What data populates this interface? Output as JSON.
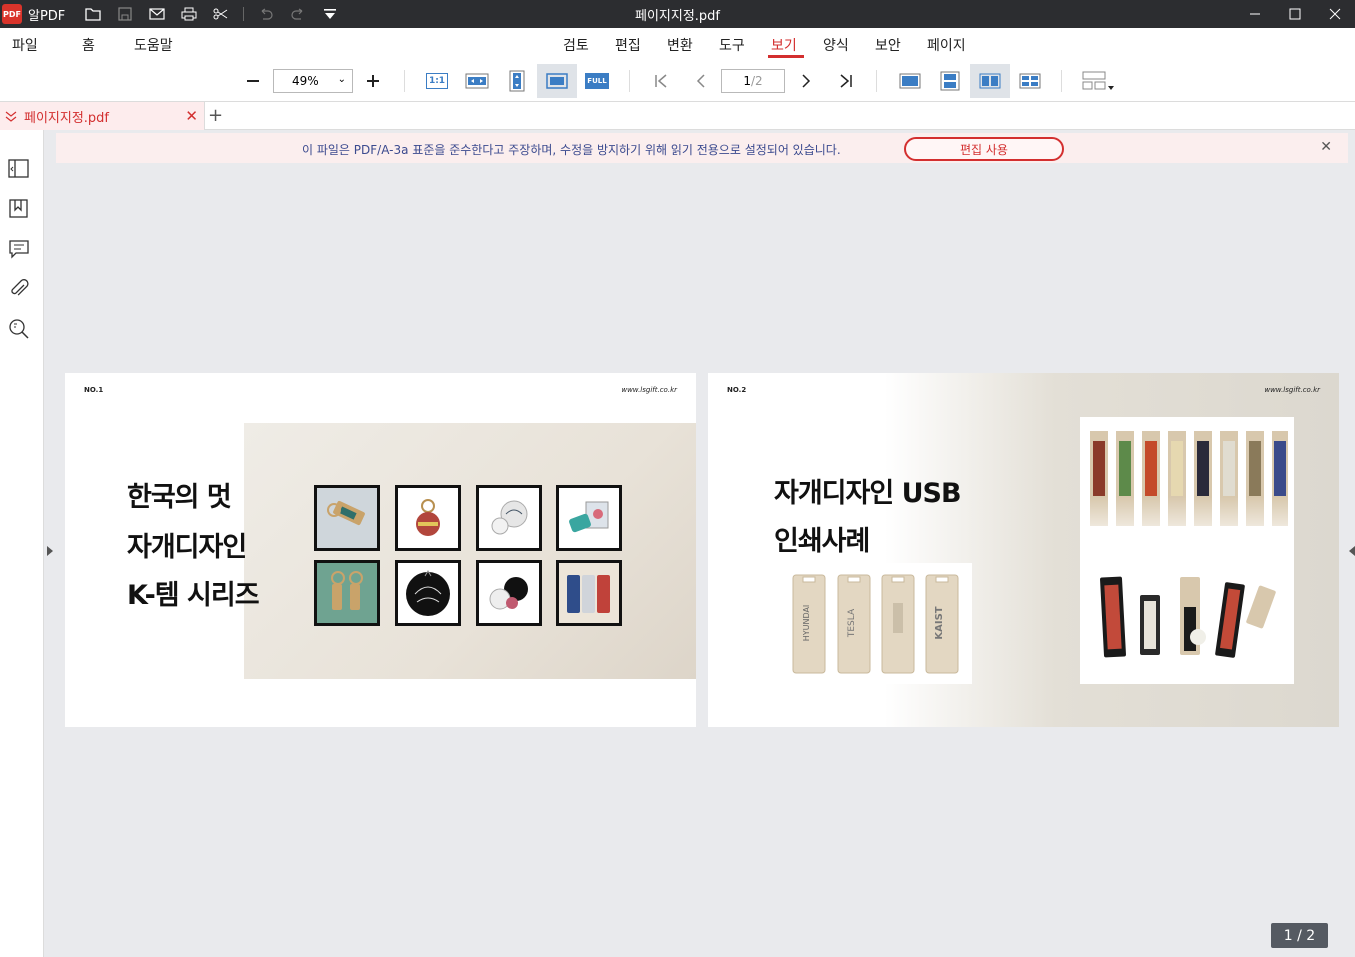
{
  "app": {
    "name": "알PDF",
    "window_title": "페이지지정.pdf"
  },
  "menu": {
    "items": [
      "파일",
      "홈",
      "도움말",
      "검토",
      "편집",
      "변환",
      "도구",
      "보기",
      "양식",
      "보안",
      "페이지"
    ],
    "active": "보기"
  },
  "toolbar": {
    "zoom_value": "49%",
    "page_current": "1",
    "page_total": "/2",
    "actual_size_label": "1:1",
    "full_label": "FULL"
  },
  "tab": {
    "filename": "페이지지정.pdf"
  },
  "notice": {
    "message": "이 파일은 PDF/A-3a 표준을 준수한다고 주장하며, 수정을 방지하기 위해 읽기 전용으로 설정되어 있습니다.",
    "button_label": "편집 사용"
  },
  "pages": [
    {
      "number_label": "NO.1",
      "url": "www.lsgift.co.kr",
      "headline": [
        "한국의 멋",
        "자개디자인",
        "K-템 시리즈"
      ]
    },
    {
      "number_label": "NO.2",
      "url": "www.lsgift.co.kr",
      "headline": [
        "자개디자인 USB",
        "인쇄사례"
      ],
      "usb_logos": [
        "HYUNDAI",
        "TESLA",
        "KAIST"
      ]
    }
  ],
  "page_counter": "1 / 2",
  "colors": {
    "accent": "#d32f2f",
    "titlebar": "#2c2d30",
    "notice_bg": "#fbeeee"
  }
}
